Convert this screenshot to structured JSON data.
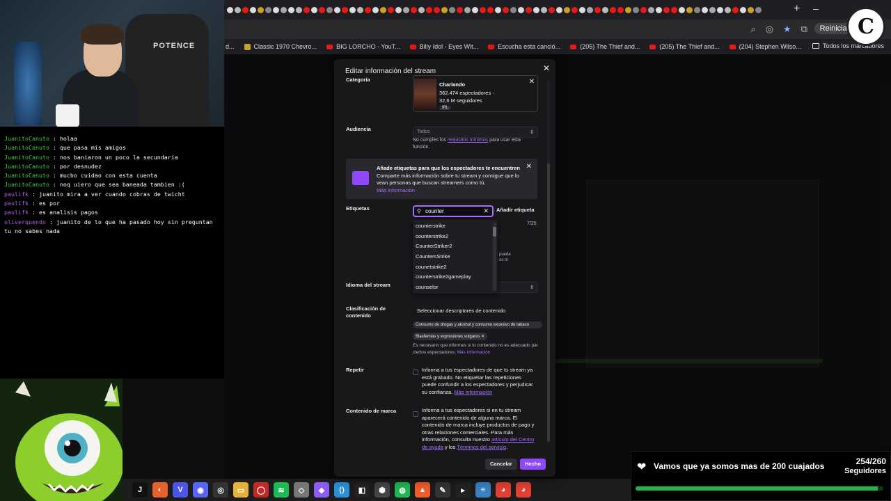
{
  "browser": {
    "profile_chip": "Reinicia pa",
    "bookmarks": [
      {
        "label": "d...",
        "kind": "gen"
      },
      {
        "label": "Classic 1970 Chevro...",
        "kind": "gen"
      },
      {
        "label": "BIG LORCHO - YouT...",
        "kind": "yt"
      },
      {
        "label": "Billy Idol - Eyes Wit...",
        "kind": "yt"
      },
      {
        "label": "Escucha esta canció...",
        "kind": "yt"
      },
      {
        "label": "(205) The Thief and...",
        "kind": "yt"
      },
      {
        "label": "(205) The Thief and...",
        "kind": "yt"
      },
      {
        "label": "(204) Stephen Wilso...",
        "kind": "yt"
      }
    ],
    "all_bookmarks": "Todos los marcadores"
  },
  "webcam": {
    "chair_logo": "POTENCE"
  },
  "chat": [
    {
      "user": "JuanitoCanuto",
      "color": "green",
      "text": "holaa"
    },
    {
      "user": "JuanitoCanuto",
      "color": "green",
      "text": "que pasa mis amigos"
    },
    {
      "user": "JuanitoCanuto",
      "color": "green",
      "text": "nos baniaron un poco la secundaria"
    },
    {
      "user": "JuanitoCanuto",
      "color": "green",
      "text": "por desnudez"
    },
    {
      "user": "JuanitoCanuto",
      "color": "green",
      "text": "mucho cuidao con esta cuenta"
    },
    {
      "user": "JuanitoCanuto",
      "color": "green",
      "text": "noq uiero que sea baneada tambien :("
    },
    {
      "user": "paulifk",
      "color": "purple",
      "text": "juanito mira a ver cuando cobras de twicht"
    },
    {
      "user": "paulifk",
      "color": "purple",
      "text": "es por"
    },
    {
      "user": "paulifk",
      "color": "purple",
      "text": "es analisis pagos"
    },
    {
      "user": "oliverquendo",
      "color": "purple",
      "text": "juanito de lo que ha pasado hoy sin preguntan tu no sabes nada"
    }
  ],
  "modal": {
    "title": "Editar información del stream",
    "category_label": "Categoría",
    "category": {
      "name": "Charlando",
      "viewers": "362.474 espectadores ·",
      "followers": "32,6 M seguidores",
      "tag": "IRL"
    },
    "audience_label": "Audiencia",
    "audience_value": "Todos",
    "audience_note_pre": "No cumples los ",
    "audience_note_link": "requisitos mínimos",
    "audience_note_post": " para usar esta función.",
    "promo": {
      "title": "Añade etiquetas para que los espectadores te encuentren",
      "body": "Comparte más información sobre tu stream y consigue que lo vean personas que buscan streamers como tú.",
      "link": "Más información"
    },
    "tags_label": "Etiquetas",
    "tag_query": "counter",
    "add_tag": "Añadir etiqueta",
    "tag_count": "7/25",
    "suggestions": [
      "counterstrike",
      "counterstrike2",
      "CounterStriker2",
      "CountersStrike",
      "counetstrike2",
      "counterstrike2gameplay",
      "counselor"
    ],
    "hidden_text_1": "puede",
    "hidden_text_2": "os ni",
    "language_label": "Idioma del stream",
    "classification_label_1": "Clasificación de",
    "classification_label_2": "contenido",
    "classification_select": "Seleccionar descriptores de contenido",
    "chip_drugs": "Consumo de drogas y alcohol y consumo excesivo de tabaco",
    "chip_profanity": "Blasfemias y expresiones vulgares ✕",
    "classification_note_1": "Es necesario que informes si tu contenido no es adecuado par",
    "classification_note_2": "ciertos espectadores.",
    "classification_link": "Más información",
    "repeat_label": "Repetir",
    "repeat_text": "Informa a tus espectadores de que tu stream ya está grabado. No etiquetar las repeticiones puede confundir a los espectadores y perjudicar su confianza.",
    "repeat_link": "Más información",
    "branded_label": "Contenido de marca",
    "branded_text": "Informa a tus espectadores si en tu stream aparecerá contenido de alguna marca. El contenido de marca incluye productos de pago y otras relaciones comerciales. Para más información, consulta nuestro",
    "branded_link_1": "artículo del Centro de ayuda",
    "branded_mid": " y los ",
    "branded_link_2": "Términos del servicio",
    "branded_end": ".",
    "cancel": "Cancelar",
    "done": "Hecho"
  },
  "goal": {
    "title": "Vamos que ya somos mas de 200 cuajados",
    "count": "254/260",
    "label": "Seguidores",
    "current": 254,
    "target": 260
  },
  "logo_letter": "C",
  "colors": {
    "accent": "#9147ff",
    "goal_fill": "#22b447",
    "chat_green": "#49c84a",
    "chat_purple": "#b15ee0"
  }
}
